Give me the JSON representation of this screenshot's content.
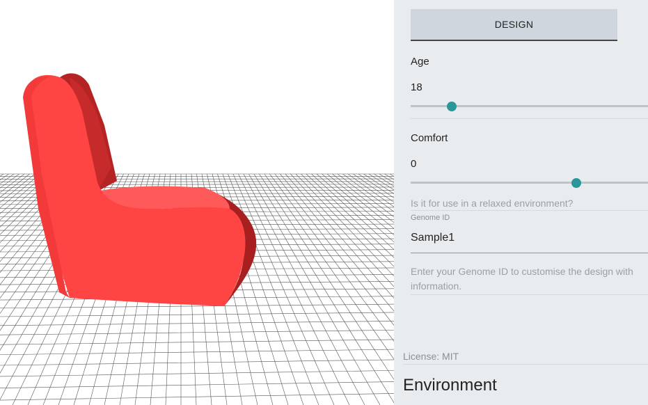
{
  "panel": {
    "design_button_label": "DESIGN",
    "age": {
      "label": "Age",
      "value": "18",
      "slider_fraction": 0.17
    },
    "comfort": {
      "label": "Comfort",
      "value": "0",
      "slider_fraction": 0.69,
      "hint": "Is it for use in a relaxed environment?"
    },
    "genome": {
      "label": "Genome ID",
      "value": "Sample1",
      "hint": "Enter your Genome ID to customise the design with\ninformation."
    },
    "license": "License: MIT",
    "section_title": "Environment"
  },
  "viewport": {
    "model": "chair",
    "model_color": "#ff4444",
    "grid_color": "#555555"
  }
}
